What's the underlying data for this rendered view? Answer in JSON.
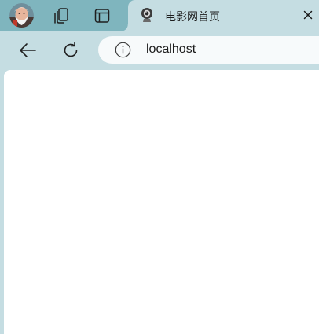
{
  "tabstrip": {
    "profile_icon": "avatar",
    "workspaces_icon": "workspaces-icon",
    "tab_actions_icon": "tab-actions-icon"
  },
  "tab": {
    "title": "电影网首页",
    "favicon": "webcam-favicon-icon",
    "close_icon": "close-icon"
  },
  "toolbar": {
    "back_icon": "back-arrow-icon",
    "refresh_icon": "refresh-icon",
    "address": {
      "info_icon": "info-icon",
      "url": "localhost"
    }
  },
  "colors": {
    "tabstrip_bg": "#7fb5be",
    "toolbar_bg": "#c5dde2",
    "address_bg": "#f7fafb",
    "page_bg": "#ffffff"
  }
}
